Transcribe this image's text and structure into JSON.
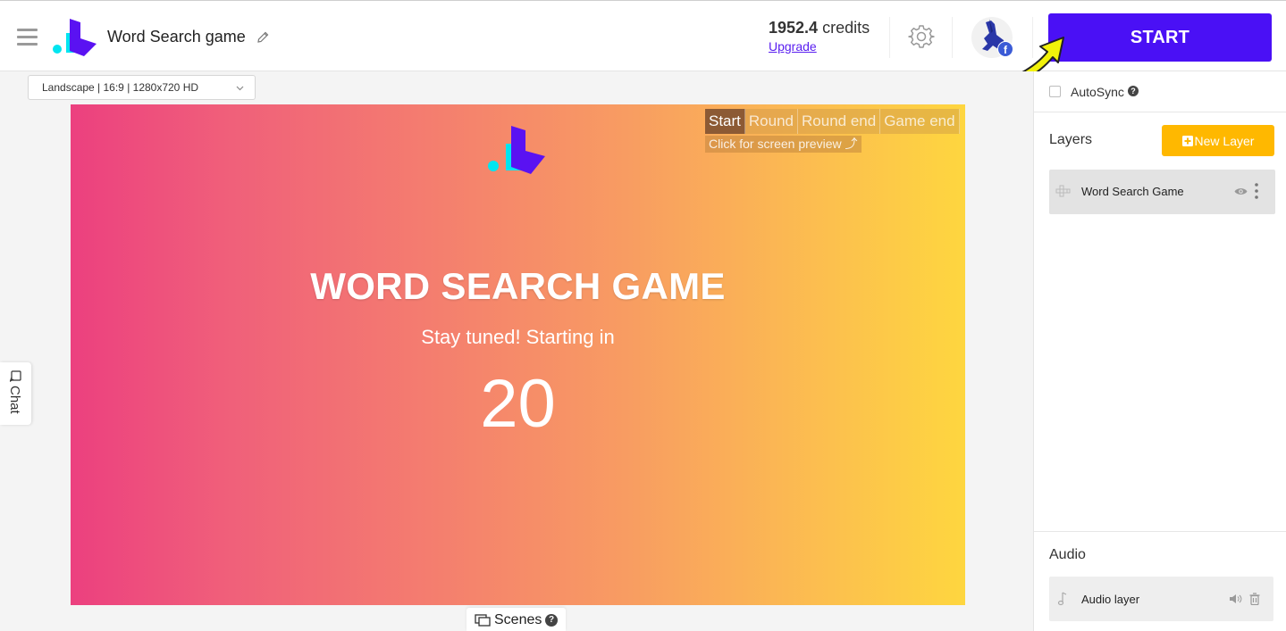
{
  "header": {
    "app_title": "Word Search game",
    "credits_value": "1952.4",
    "credits_unit": "credits",
    "upgrade_label": "Upgrade",
    "start_label": "START",
    "avatar_badge": "f"
  },
  "toolbar": {
    "orientation_select_value": "Landscape | 16:9 | 1280x720 HD"
  },
  "canvas": {
    "screen_tabs": [
      "Start",
      "Round",
      "Round end",
      "Game end"
    ],
    "active_tab": "Start",
    "preview_hint": "Click for screen preview ⤴",
    "game_title": "WORD SEARCH GAME",
    "subtitle": "Stay tuned! Starting in",
    "countdown": "20"
  },
  "side_tabs": {
    "chat_label": "Chat",
    "scenes_label": "Scenes",
    "help_glyph": "?"
  },
  "right_panel": {
    "autosync_label": "AutoSync",
    "layers_heading": "Layers",
    "new_layer_label": "New Layer",
    "layers": [
      {
        "label": "Word Search Game"
      }
    ],
    "audio_heading": "Audio",
    "audio_items": [
      {
        "label": "Audio layer"
      }
    ]
  },
  "colors": {
    "brand_purple": "#4a10f5",
    "brand_cyan": "#00e5f0",
    "new_layer_yellow": "#ffb800",
    "gradient_start": "#ec407f",
    "gradient_end": "#fed63f"
  },
  "icons": [
    "menu-icon",
    "logo",
    "pencil-icon",
    "gear-icon",
    "avatar",
    "chevron-down-icon",
    "chat-icon",
    "scenes-icon",
    "help-icon",
    "plus-icon",
    "grid-icon",
    "eye-icon",
    "kebab-icon",
    "music-note-icon",
    "volume-icon",
    "trash-icon",
    "arrow-annotation"
  ]
}
